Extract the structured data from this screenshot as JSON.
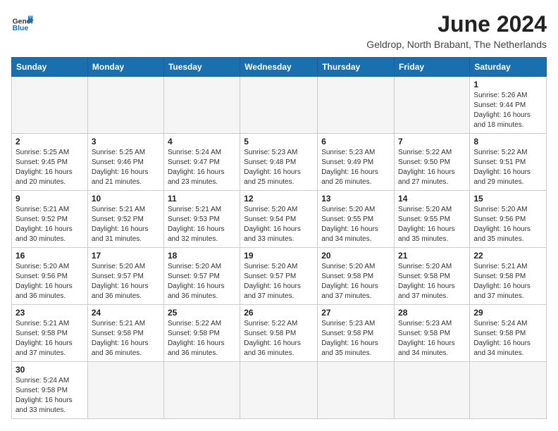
{
  "header": {
    "logo_general": "General",
    "logo_blue": "Blue",
    "month_year": "June 2024",
    "location": "Geldrop, North Brabant, The Netherlands"
  },
  "weekdays": [
    "Sunday",
    "Monday",
    "Tuesday",
    "Wednesday",
    "Thursday",
    "Friday",
    "Saturday"
  ],
  "weeks": [
    [
      {
        "day": "",
        "info": ""
      },
      {
        "day": "",
        "info": ""
      },
      {
        "day": "",
        "info": ""
      },
      {
        "day": "",
        "info": ""
      },
      {
        "day": "",
        "info": ""
      },
      {
        "day": "",
        "info": ""
      },
      {
        "day": "1",
        "info": "Sunrise: 5:26 AM\nSunset: 9:44 PM\nDaylight: 16 hours\nand 18 minutes."
      }
    ],
    [
      {
        "day": "2",
        "info": "Sunrise: 5:25 AM\nSunset: 9:45 PM\nDaylight: 16 hours\nand 20 minutes."
      },
      {
        "day": "3",
        "info": "Sunrise: 5:25 AM\nSunset: 9:46 PM\nDaylight: 16 hours\nand 21 minutes."
      },
      {
        "day": "4",
        "info": "Sunrise: 5:24 AM\nSunset: 9:47 PM\nDaylight: 16 hours\nand 23 minutes."
      },
      {
        "day": "5",
        "info": "Sunrise: 5:23 AM\nSunset: 9:48 PM\nDaylight: 16 hours\nand 25 minutes."
      },
      {
        "day": "6",
        "info": "Sunrise: 5:23 AM\nSunset: 9:49 PM\nDaylight: 16 hours\nand 26 minutes."
      },
      {
        "day": "7",
        "info": "Sunrise: 5:22 AM\nSunset: 9:50 PM\nDaylight: 16 hours\nand 27 minutes."
      },
      {
        "day": "8",
        "info": "Sunrise: 5:22 AM\nSunset: 9:51 PM\nDaylight: 16 hours\nand 29 minutes."
      }
    ],
    [
      {
        "day": "9",
        "info": "Sunrise: 5:21 AM\nSunset: 9:52 PM\nDaylight: 16 hours\nand 30 minutes."
      },
      {
        "day": "10",
        "info": "Sunrise: 5:21 AM\nSunset: 9:52 PM\nDaylight: 16 hours\nand 31 minutes."
      },
      {
        "day": "11",
        "info": "Sunrise: 5:21 AM\nSunset: 9:53 PM\nDaylight: 16 hours\nand 32 minutes."
      },
      {
        "day": "12",
        "info": "Sunrise: 5:20 AM\nSunset: 9:54 PM\nDaylight: 16 hours\nand 33 minutes."
      },
      {
        "day": "13",
        "info": "Sunrise: 5:20 AM\nSunset: 9:55 PM\nDaylight: 16 hours\nand 34 minutes."
      },
      {
        "day": "14",
        "info": "Sunrise: 5:20 AM\nSunset: 9:55 PM\nDaylight: 16 hours\nand 35 minutes."
      },
      {
        "day": "15",
        "info": "Sunrise: 5:20 AM\nSunset: 9:56 PM\nDaylight: 16 hours\nand 35 minutes."
      }
    ],
    [
      {
        "day": "16",
        "info": "Sunrise: 5:20 AM\nSunset: 9:56 PM\nDaylight: 16 hours\nand 36 minutes."
      },
      {
        "day": "17",
        "info": "Sunrise: 5:20 AM\nSunset: 9:57 PM\nDaylight: 16 hours\nand 36 minutes."
      },
      {
        "day": "18",
        "info": "Sunrise: 5:20 AM\nSunset: 9:57 PM\nDaylight: 16 hours\nand 36 minutes."
      },
      {
        "day": "19",
        "info": "Sunrise: 5:20 AM\nSunset: 9:57 PM\nDaylight: 16 hours\nand 37 minutes."
      },
      {
        "day": "20",
        "info": "Sunrise: 5:20 AM\nSunset: 9:58 PM\nDaylight: 16 hours\nand 37 minutes."
      },
      {
        "day": "21",
        "info": "Sunrise: 5:20 AM\nSunset: 9:58 PM\nDaylight: 16 hours\nand 37 minutes."
      },
      {
        "day": "22",
        "info": "Sunrise: 5:21 AM\nSunset: 9:58 PM\nDaylight: 16 hours\nand 37 minutes."
      }
    ],
    [
      {
        "day": "23",
        "info": "Sunrise: 5:21 AM\nSunset: 9:58 PM\nDaylight: 16 hours\nand 37 minutes."
      },
      {
        "day": "24",
        "info": "Sunrise: 5:21 AM\nSunset: 9:58 PM\nDaylight: 16 hours\nand 36 minutes."
      },
      {
        "day": "25",
        "info": "Sunrise: 5:22 AM\nSunset: 9:58 PM\nDaylight: 16 hours\nand 36 minutes."
      },
      {
        "day": "26",
        "info": "Sunrise: 5:22 AM\nSunset: 9:58 PM\nDaylight: 16 hours\nand 36 minutes."
      },
      {
        "day": "27",
        "info": "Sunrise: 5:23 AM\nSunset: 9:58 PM\nDaylight: 16 hours\nand 35 minutes."
      },
      {
        "day": "28",
        "info": "Sunrise: 5:23 AM\nSunset: 9:58 PM\nDaylight: 16 hours\nand 34 minutes."
      },
      {
        "day": "29",
        "info": "Sunrise: 5:24 AM\nSunset: 9:58 PM\nDaylight: 16 hours\nand 34 minutes."
      }
    ],
    [
      {
        "day": "30",
        "info": "Sunrise: 5:24 AM\nSunset: 9:58 PM\nDaylight: 16 hours\nand 33 minutes."
      },
      {
        "day": "",
        "info": ""
      },
      {
        "day": "",
        "info": ""
      },
      {
        "day": "",
        "info": ""
      },
      {
        "day": "",
        "info": ""
      },
      {
        "day": "",
        "info": ""
      },
      {
        "day": "",
        "info": ""
      }
    ]
  ]
}
